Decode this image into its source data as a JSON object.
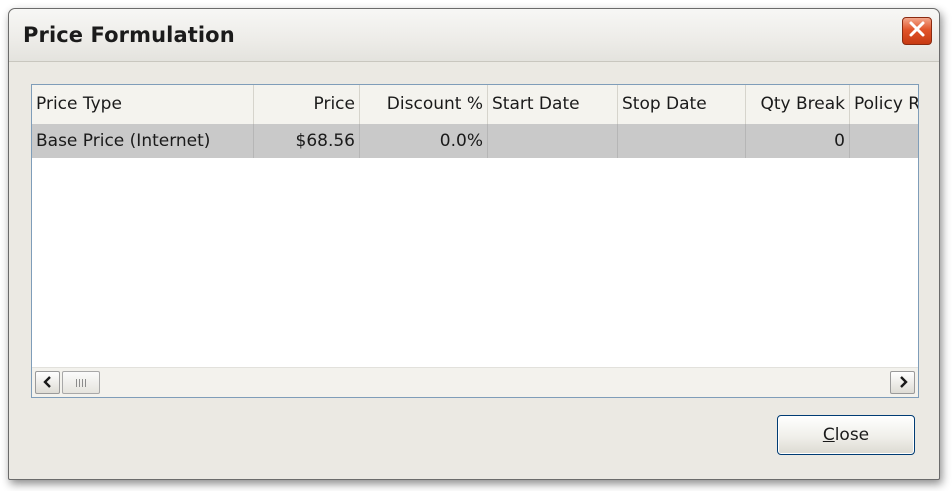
{
  "window": {
    "title": "Price Formulation"
  },
  "grid": {
    "columns": [
      {
        "label": "Price Type",
        "align": "left"
      },
      {
        "label": "Price",
        "align": "right"
      },
      {
        "label": "Discount %",
        "align": "right"
      },
      {
        "label": "Start Date",
        "align": "left"
      },
      {
        "label": "Stop Date",
        "align": "left"
      },
      {
        "label": "Qty Break",
        "align": "right"
      },
      {
        "label": "Policy R",
        "align": "left"
      }
    ],
    "rows": [
      {
        "price_type": "Base Price (Internet)",
        "price": "$68.56",
        "discount": "0.0%",
        "start_date": "",
        "stop_date": "",
        "qty_break": "0",
        "policy": ""
      }
    ],
    "selected_row_color": "#c9c9c9"
  },
  "buttons": {
    "close_first": "C",
    "close_rest": "lose"
  },
  "icons": {
    "title_close": "close-icon",
    "scroll_left": "chevron-left-icon",
    "scroll_right": "chevron-right-icon",
    "thumb_grip": "grip-icon"
  },
  "colors": {
    "title_close_bg": "#e1542a",
    "grid_border": "#7f9db9",
    "dialog_bg": "#ebe9e3"
  }
}
